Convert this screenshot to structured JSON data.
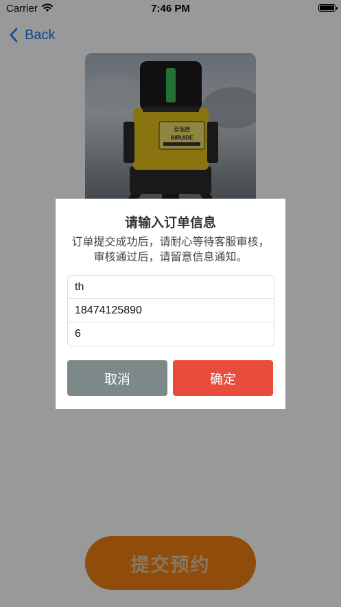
{
  "status_bar": {
    "carrier": "Carrier",
    "time": "7:46 PM",
    "battery_level": 1.0
  },
  "nav": {
    "back_label": "Back",
    "back_icon": "chevron-left-icon"
  },
  "product": {
    "brand_text": "爱瑞德",
    "brand_latin": "AIRUIDE"
  },
  "submit_button": {
    "label": "提交预约",
    "color": "#f07f12"
  },
  "dialog": {
    "title": "请输入订单信息",
    "message": "订单提交成功后，请耐心等待客服审核，审核通过后，请留意信息通知。",
    "fields": [
      {
        "value": "th"
      },
      {
        "value": "18474125890"
      },
      {
        "value": "6"
      }
    ],
    "cancel_label": "取消",
    "confirm_label": "确定",
    "cancel_color": "#7d8989",
    "confirm_color": "#e84c3d"
  },
  "colors": {
    "accent": "#1478f6",
    "overlay": "rgba(0,0,0,0.4)"
  }
}
